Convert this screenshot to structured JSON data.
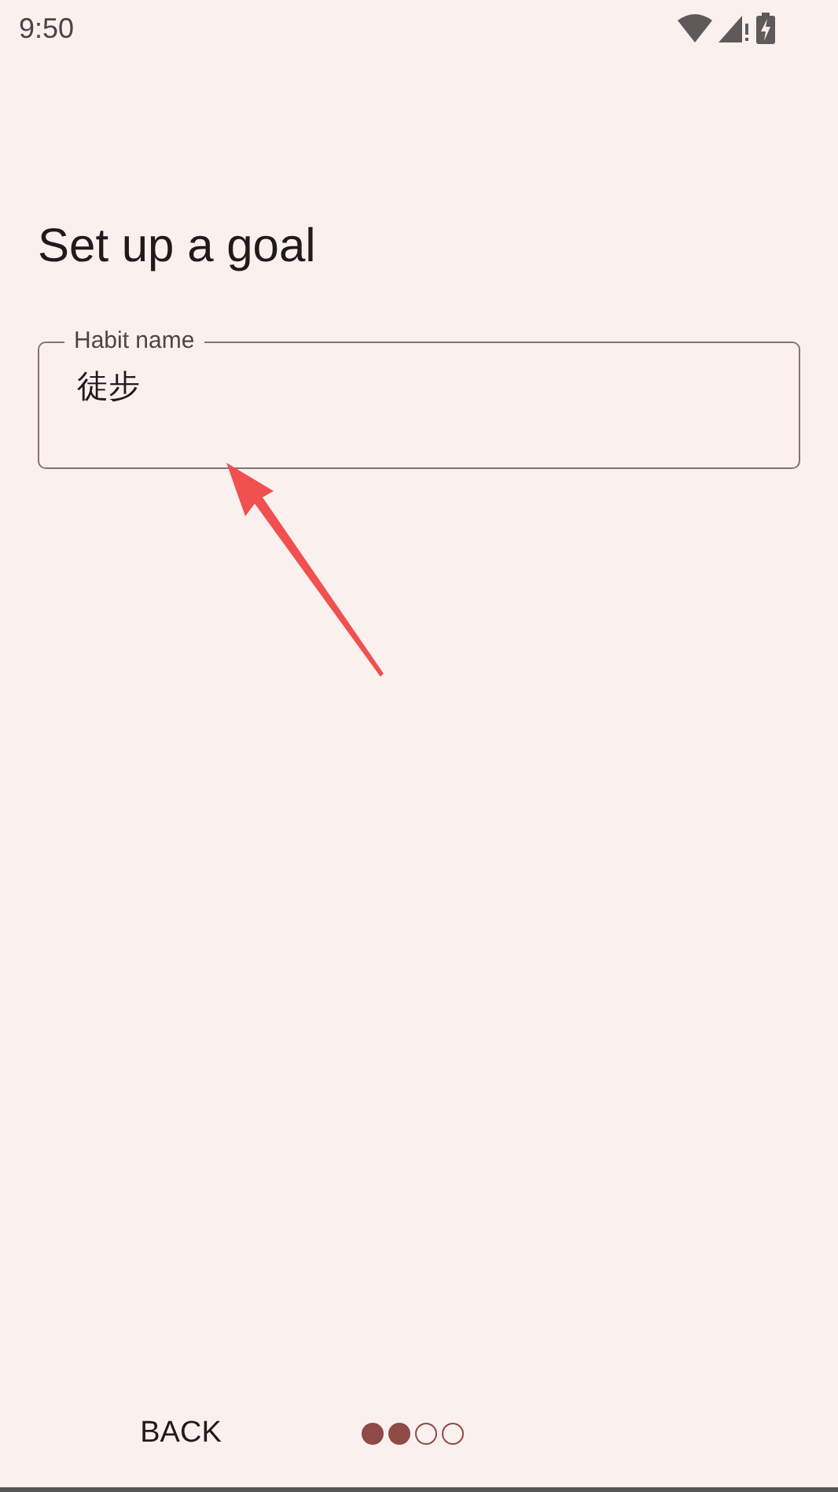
{
  "status_bar": {
    "time": "9:50"
  },
  "title": "Set up a goal",
  "habit_field": {
    "label": "Habit name",
    "value": "徒步"
  },
  "bottom_bar": {
    "back_button": "BACK",
    "steps": [
      {
        "filled": true
      },
      {
        "filled": true
      },
      {
        "filled": false
      },
      {
        "filled": false
      }
    ]
  }
}
